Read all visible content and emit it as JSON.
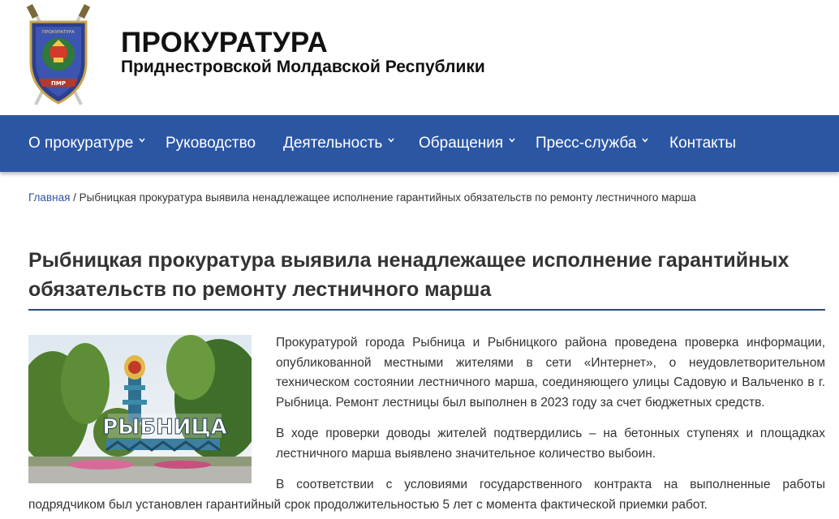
{
  "site": {
    "title": "ПРОКУРАТУРА",
    "subtitle": "Приднестровской Молдавской Республики",
    "logo_text": "ПРОКУРАТУРА ПМР"
  },
  "nav": {
    "items": [
      {
        "label": "О прокуратуре",
        "has_dropdown": true
      },
      {
        "label": "Руководство",
        "has_dropdown": false
      },
      {
        "label": "Деятельность",
        "has_dropdown": true
      },
      {
        "label": "Обращения",
        "has_dropdown": true
      },
      {
        "label": "Пресс-служба",
        "has_dropdown": true
      },
      {
        "label": "Контакты",
        "has_dropdown": false
      }
    ]
  },
  "breadcrumb": {
    "home": "Главная",
    "separator": " / ",
    "current": "Рыбницкая прокуратура выявила ненадлежащее исполнение гарантийных обязательств по ремонту лестничного марша"
  },
  "article": {
    "title": "Рыбницкая прокуратура выявила ненадлежащее исполнение гарантийных обязательств по ремонту лестничного марша",
    "image_sign_text": "РЫБНИЦА",
    "paragraphs": [
      "Прокуратурой города Рыбница и Рыбницкого района проведена проверка информации, опубликованной местными жителями в сети «Интернет», о неудовлетворительном техническом состоянии лестничного марша, соединяющего улицы Садовую и Вальченко в г. Рыбница. Ремонт лестницы был выполнен в 2023 году за счет бюджетных средств.",
      "В ходе проверки доводы жителей подтвердились – на бетонных ступенях и площадках лестничного марша выявлено значительное количество выбоин.",
      "В соответствии с условиями государственного контракта на выполненные работы подрядчиком был установлен гарантийный срок продолжительностью 5 лет с момента фактической приемки работ."
    ]
  },
  "colors": {
    "nav_background": "#2b56a3",
    "link": "#2b56a3",
    "title_rule": "#2b4a78"
  }
}
